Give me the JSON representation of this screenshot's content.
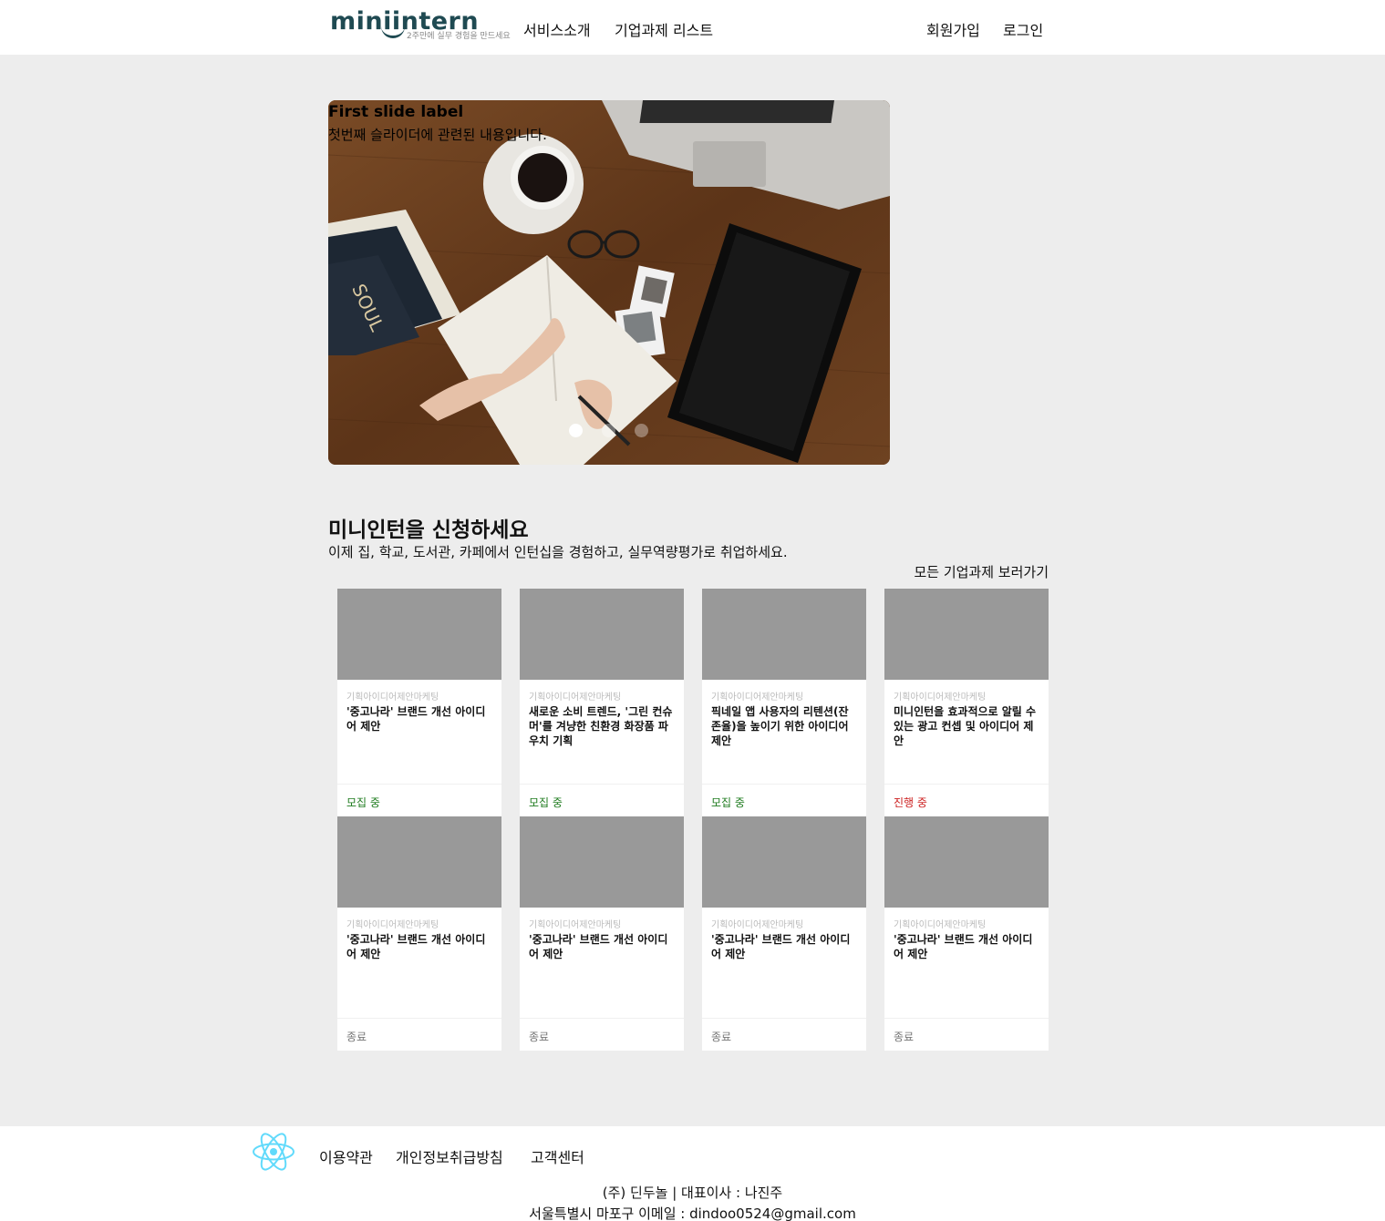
{
  "header": {
    "logo_text": "miniintern",
    "logo_tagline": "2주만에 실무 경험을 만드세요",
    "nav": [
      "서비스소개",
      "기업과제 리스트"
    ],
    "auth": [
      "회원가입",
      "로그인"
    ]
  },
  "carousel": {
    "title": "First slide label",
    "text": "첫번째 슬라이더에 관련된 내용입니다.",
    "slide_count": 3,
    "active_index": 0
  },
  "section": {
    "title": "미니인턴을 신청하세요",
    "subtitle": "이제 집, 학교, 도서관, 카페에서 인턴십을 경험하고, 실무역량평가로 취업하세요.",
    "see_all": "모든 기업과제 보러가기"
  },
  "cards": [
    {
      "category": "기획아이디어제안마케팅",
      "title": "'중고나라' 브랜드 개선 아이디어 제안",
      "status": "모집 중",
      "status_type": "open"
    },
    {
      "category": "기획아이디어제안마케팅",
      "title": "새로운 소비 트렌드, '그린 컨슈머'를 겨냥한 친환경 화장품 파우치 기획",
      "status": "모집 중",
      "status_type": "open"
    },
    {
      "category": "기획아이디어제안마케팅",
      "title": "픽네일 앱 사용자의 리텐션(잔존율)을 높이기 위한 아이디어 제안",
      "status": "모집 중",
      "status_type": "open"
    },
    {
      "category": "기획아이디어제안마케팅",
      "title": "미니인턴을 효과적으로 알릴 수 있는 광고 컨셉 및 아이디어 제안",
      "status": "진행 중",
      "status_type": "progress"
    },
    {
      "category": "기획아이디어제안마케팅",
      "title": "'중고나라' 브랜드 개선 아이디어 제안",
      "status": "종료",
      "status_type": "end"
    },
    {
      "category": "기획아이디어제안마케팅",
      "title": "'중고나라' 브랜드 개선 아이디어 제안",
      "status": "종료",
      "status_type": "end"
    },
    {
      "category": "기획아이디어제안마케팅",
      "title": "'중고나라' 브랜드 개선 아이디어 제안",
      "status": "종료",
      "status_type": "end"
    },
    {
      "category": "기획아이디어제안마케팅",
      "title": "'중고나라' 브랜드 개선 아이디어 제안",
      "status": "종료",
      "status_type": "end"
    }
  ],
  "footer": {
    "links": [
      "이용약관",
      "개인정보취급방침",
      "고객센터"
    ],
    "company_line": "(주) 딘두놀 | 대표이사 : 나진주",
    "address_line": "서울특별시 마포구 이메일 : dindoo0524@gmail.com"
  },
  "colors": {
    "brand": "#1f4a52",
    "status_open": "#1e7b1e",
    "status_progress": "#cc1f1f",
    "status_end": "#777777",
    "react_icon": "#61dafb"
  }
}
